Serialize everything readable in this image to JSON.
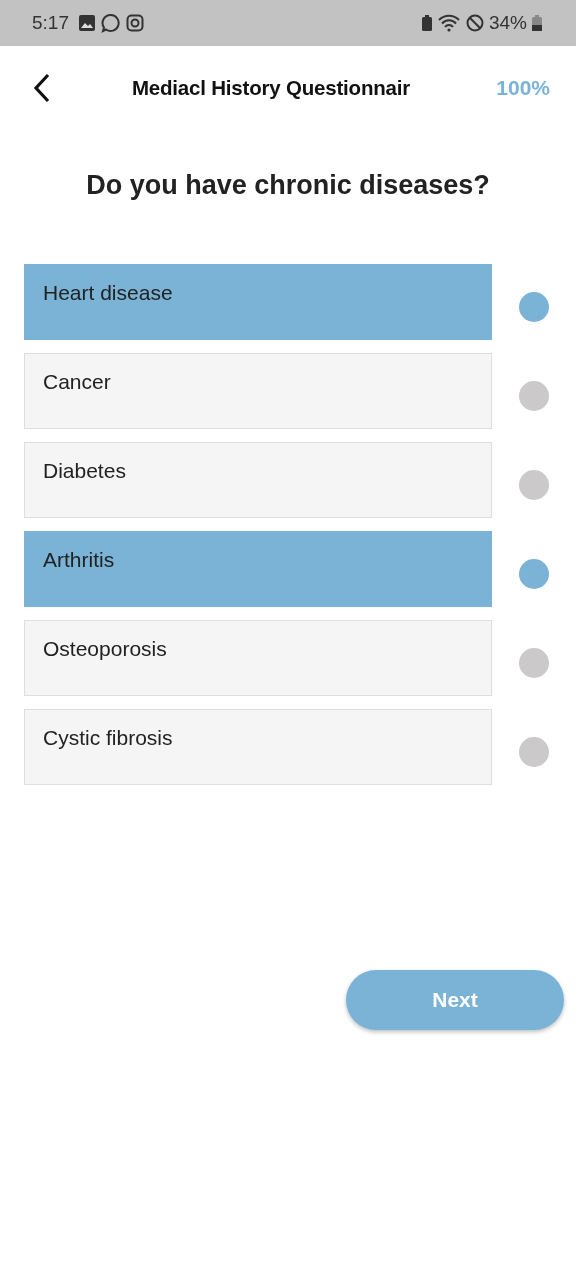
{
  "status_bar": {
    "time": "5:17",
    "battery": "34%"
  },
  "header": {
    "title": "Mediacl History Questionnair",
    "progress": "100%"
  },
  "question": "Do you have chronic diseases?",
  "options": [
    {
      "label": "Heart disease",
      "selected": true
    },
    {
      "label": "Cancer",
      "selected": false
    },
    {
      "label": "Diabetes",
      "selected": false
    },
    {
      "label": "Arthritis",
      "selected": true
    },
    {
      "label": "Osteoporosis",
      "selected": false
    },
    {
      "label": "Cystic fibrosis",
      "selected": false
    }
  ],
  "next_button": "Next"
}
